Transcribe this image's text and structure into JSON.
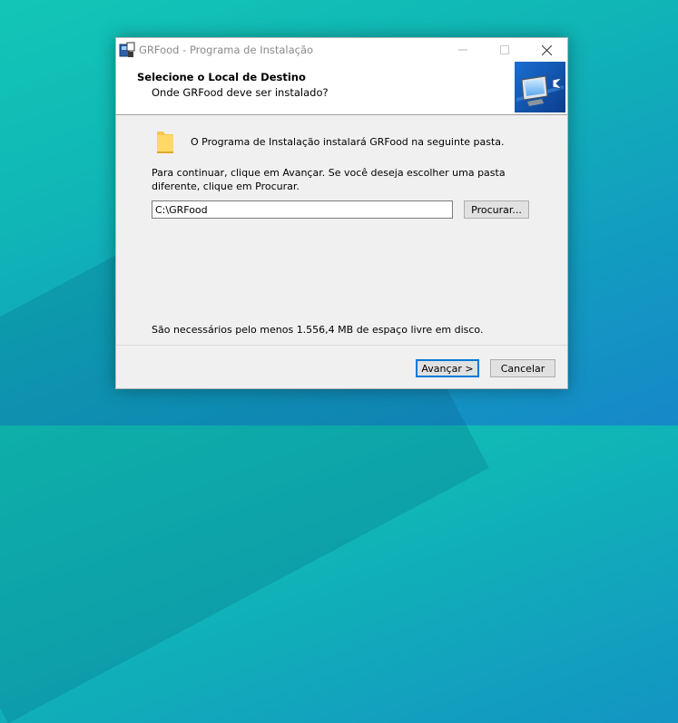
{
  "window": {
    "title": "GRFood - Programa de Instalação"
  },
  "header": {
    "title": "Selecione o Local de Destino",
    "subtitle": "Onde GRFood deve ser instalado?"
  },
  "body": {
    "info_line": "O Programa de Instalação instalará GRFood na seguinte pasta.",
    "instruction": "Para continuar, clique em Avançar. Se você deseja escolher uma pasta diferente, clique em Procurar.",
    "path_value": "C:\\GRFood",
    "browse_label": "Procurar...",
    "space_required": "São necessários pelo menos 1.556,4 MB de espaço livre em disco."
  },
  "footer": {
    "next_label": "Avançar >",
    "cancel_label": "Cancelar"
  },
  "icons": [
    "setup-app-icon",
    "minimize-icon",
    "maximize-icon",
    "close-icon",
    "wizard-computer-icon",
    "folder-icon"
  ],
  "colors": {
    "accent": "#0078d7",
    "window_bg": "#f0f0f0",
    "header_bg": "#ffffff"
  }
}
